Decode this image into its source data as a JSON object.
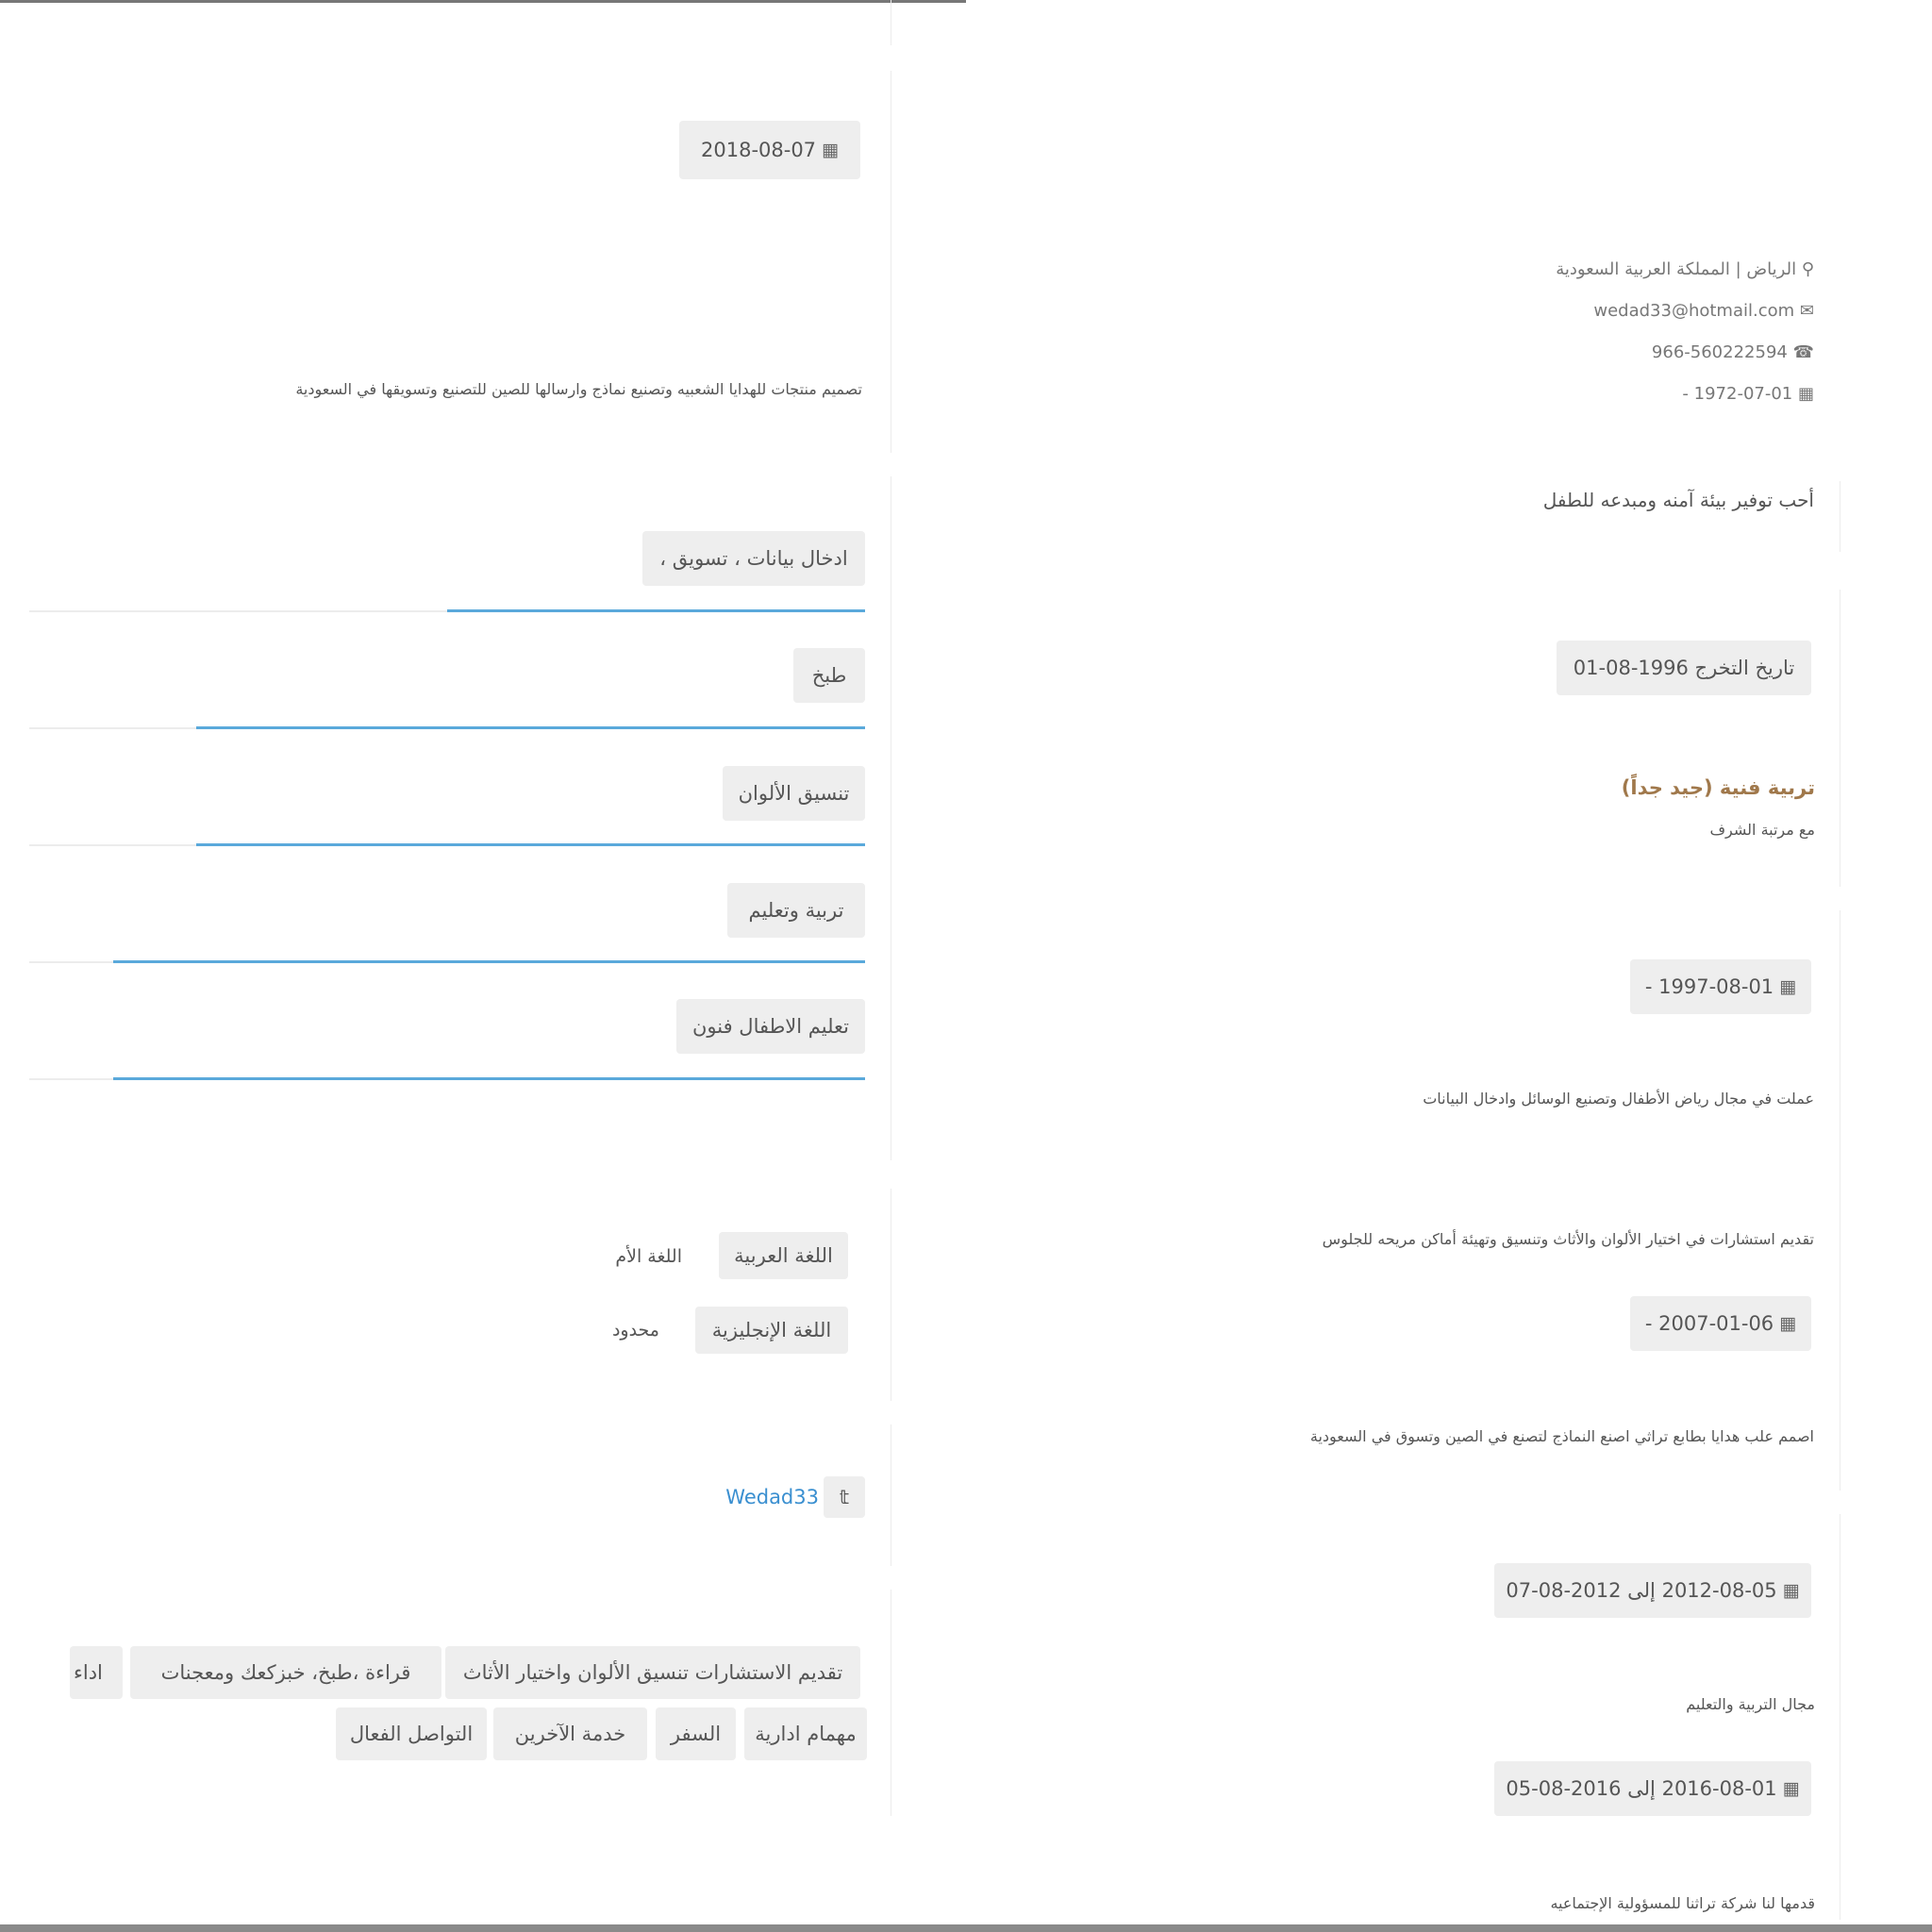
{
  "left": {
    "project_date": "2018-08-07",
    "project_desc": "تصميم منتجات للهدايا الشعبيه وتصنيع نماذج وارسالها للصين للتصنيع وتسويقها في السعودية",
    "skills": [
      {
        "label": "ادخال بيانات ، تسويق ،",
        "level_pct": 50
      },
      {
        "label": "طبخ",
        "level_pct": 80
      },
      {
        "label": "تنسيق الألوان",
        "level_pct": 80
      },
      {
        "label": "تربية وتعليم",
        "level_pct": 90
      },
      {
        "label": "تعليم الاطفال فنون",
        "level_pct": 90
      }
    ],
    "languages": [
      {
        "name": "اللغة العربية",
        "level": "اللغة الأم"
      },
      {
        "name": "اللغة الإنجليزية",
        "level": "محدود"
      }
    ],
    "twitter_handle": "Wedad33",
    "interests_row1": [
      "تقديم الاستشارات تنسيق الألوان واختيار الأثاث",
      "قراءة ،طبخ، خبزكعك ومعجنات",
      "اداء"
    ],
    "interests_row2": [
      "مهمام ادارية",
      "السفر",
      "خدمة الآخرين",
      "التواصل الفعال"
    ]
  },
  "right": {
    "location": "الرياض | المملكة العربية السعودية",
    "email": "wedad33@hotmail.com",
    "phone": "966-560222594",
    "birthdate": "1972-07-01 -",
    "objective": "أحب توفير بيئة آمنه ومبدعه للطفل",
    "graduation": "تاريخ التخرج 1996-08-01",
    "degree": "تربية فنية (جيد جداً)",
    "honor": "مع مرتبة الشرف",
    "exp1_date": "1997-08-01 -",
    "exp1_desc": "عملت في مجال رياض الأطفال وتصنيع الوسائل وادخال البيانات",
    "exp2_title": "تقديم استشارات في اختيار الألوان والأثاث وتنسيق وتهيئة أماكن مريحه للجلوس",
    "exp2_date": "2007-01-06 -",
    "exp2_desc": "اصمم علب هدايا بطابع تراثي اصنع النماذج لتصنع في الصين وتسوق في السعودية",
    "vol1_date": "2012-08-05 إلى 2012-08-07",
    "vol1_desc": "مجال التربية والتعليم",
    "vol2_date": "2016-08-01 إلى 2016-08-05",
    "vol2_desc": "قدمها لنا شركة تراثنا للمسؤولية الإجتماعيه"
  }
}
